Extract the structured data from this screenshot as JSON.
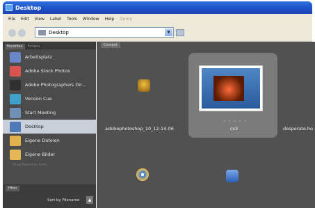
{
  "window": {
    "title": "Desktop"
  },
  "menu": [
    "File",
    "Edit",
    "View",
    "Label",
    "Tools",
    "Window",
    "Help",
    "Demo"
  ],
  "toolbar": {
    "path": "Desktop"
  },
  "left_panel": {
    "tabs": [
      "Favorites",
      "Folders"
    ],
    "favorites": [
      {
        "label": "Arbeitsplatz",
        "color": "#6a86c8"
      },
      {
        "label": "Adobe Stock Photos",
        "color": "#d9534f"
      },
      {
        "label": "Adobe Photographers Dir...",
        "color": "#2f2f2f"
      },
      {
        "label": "Version Cue",
        "color": "#3fa1c9"
      },
      {
        "label": "Start Meeting",
        "color": "#6f8fb5"
      },
      {
        "label": "Desktop",
        "color": "#4e79b8",
        "selected": true
      },
      {
        "label": "Eigene Dateien",
        "color": "#e2b14b"
      },
      {
        "label": "Eigene Bilder",
        "color": "#e6b855"
      }
    ],
    "hint": "Drag Favorites here...",
    "filter_tab": "Filter",
    "sort_label": "Sort by Filename"
  },
  "content": {
    "tab": "Content",
    "items": [
      {
        "label": "adobephotoshop_10_12-14-06",
        "icon": "installer-icon"
      },
      {
        "label": "cs3",
        "icon": "image-thumbnail"
      },
      {
        "label": "desperate.ho",
        "icon": "file-icon"
      }
    ],
    "row2_icons": [
      "cd-icon",
      "document-icon"
    ]
  }
}
